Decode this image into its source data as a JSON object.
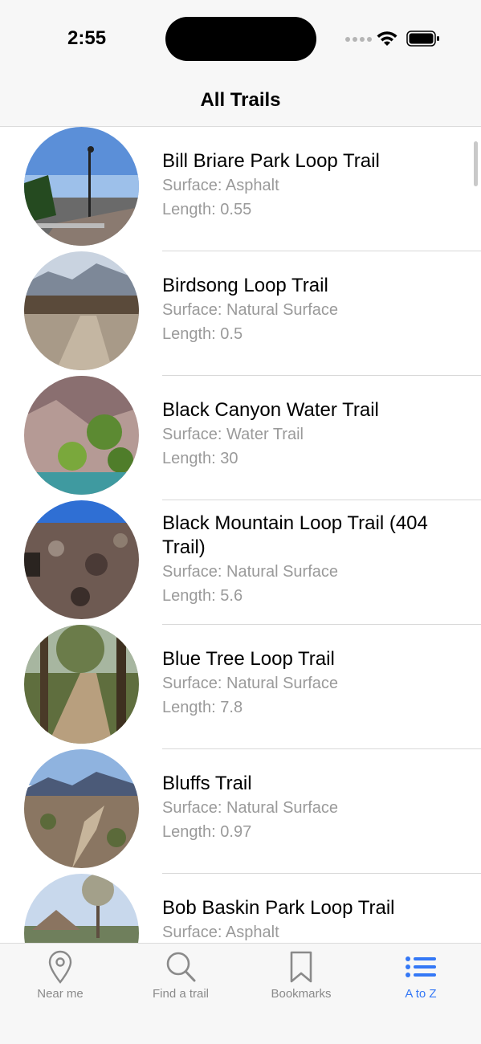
{
  "status": {
    "time": "2:55"
  },
  "nav": {
    "title": "All Trails"
  },
  "trails": [
    {
      "name": "Bill Briare Park Loop Trail",
      "surface": "Surface: Asphalt",
      "length": "Length: 0.55"
    },
    {
      "name": "Birdsong Loop Trail",
      "surface": "Surface: Natural Surface",
      "length": "Length: 0.5"
    },
    {
      "name": "Black Canyon Water Trail",
      "surface": "Surface: Water Trail",
      "length": "Length: 30"
    },
    {
      "name": "Black Mountain Loop Trail (404 Trail)",
      "surface": "Surface: Natural Surface",
      "length": "Length: 5.6"
    },
    {
      "name": "Blue Tree Loop Trail",
      "surface": "Surface: Natural Surface",
      "length": "Length: 7.8"
    },
    {
      "name": "Bluffs Trail",
      "surface": "Surface: Natural Surface",
      "length": "Length: 0.97"
    },
    {
      "name": "Bob Baskin Park Loop Trail",
      "surface": "Surface: Asphalt",
      "length": ""
    }
  ],
  "tabs": [
    {
      "label": "Near me",
      "icon": "location-pin-icon"
    },
    {
      "label": "Find a trail",
      "icon": "search-icon"
    },
    {
      "label": "Bookmarks",
      "icon": "bookmark-icon"
    },
    {
      "label": "A to Z",
      "icon": "list-icon",
      "active": true
    }
  ],
  "colors": {
    "accent": "#3478f6",
    "secondary_text": "#9a9a9a"
  }
}
